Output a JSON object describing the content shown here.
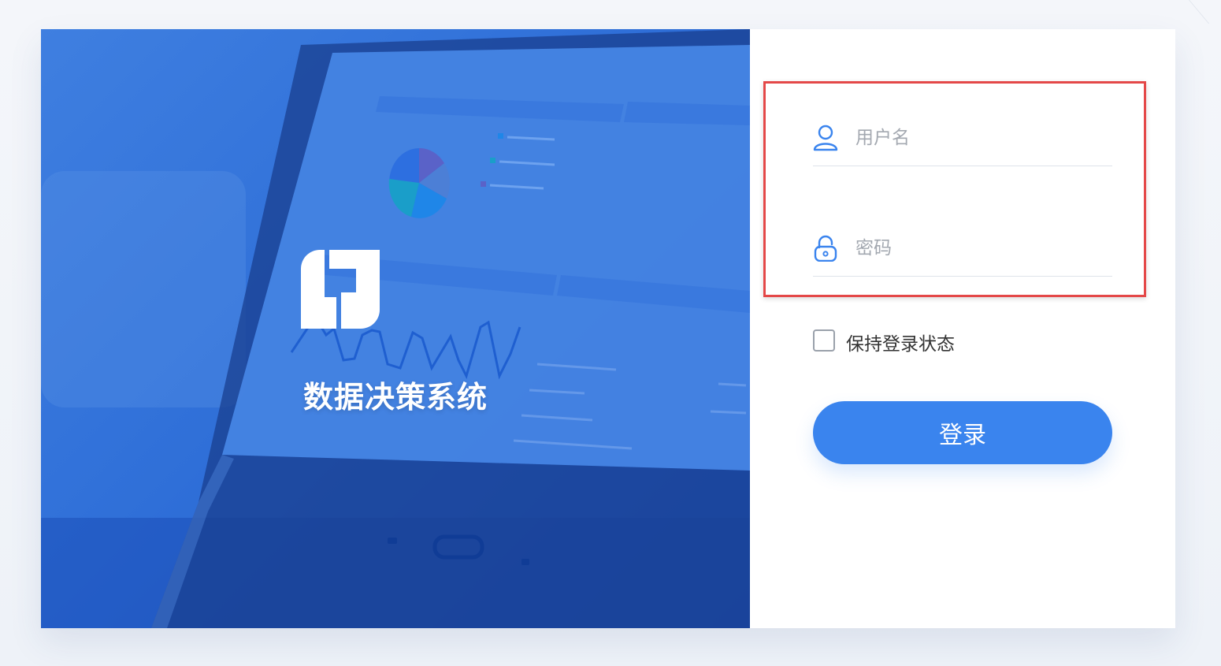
{
  "brand": {
    "title": "数据决策系统",
    "logo_icon": "logo-icon"
  },
  "hero": {
    "background_icon": "tablet-dashboard-illustration",
    "accent_color": "#2f6fd8"
  },
  "login": {
    "username_placeholder": "用户名",
    "password_placeholder": "密码",
    "remember_label": "保持登录状态",
    "remember_checked": false,
    "submit_label": "登录",
    "user_icon": "user-icon",
    "lock_icon": "lock-icon",
    "button_color": "#3a84ee",
    "highlight_color": "#e44848"
  }
}
